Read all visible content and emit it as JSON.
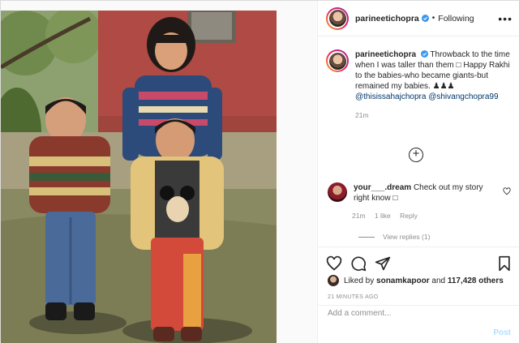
{
  "post": {
    "username": "parineetichopra",
    "follow_status": "Following",
    "dot": "•",
    "caption_text": "Throwback to the time when I was taller than them ",
    "caption_glyph": "□",
    "caption_text2": " Happy Rakhi to the babies-who became giants-but remained my babies. ",
    "caption_emoji": "♟♟♟",
    "mention1": "@thisissahajchopra",
    "mention2": "@shivangchopra99",
    "caption_time": "21m"
  },
  "comment": {
    "username": "your___.dream",
    "text": "Check out my story right know ",
    "glyph": "□",
    "time": "21m",
    "likes": "1 like",
    "reply": "Reply",
    "view_replies": "View replies (1)"
  },
  "likes": {
    "prefix": "Liked by",
    "user": "sonamkapoor",
    "and": "and",
    "count": "117,428 others"
  },
  "posted_ago": "21 MINUTES AGO",
  "add_comment": {
    "placeholder": "Add a comment...",
    "post_label": "Post"
  },
  "icons": {
    "verified": "verified-badge-icon",
    "more": "more-options-icon",
    "heart": "heart-icon",
    "comment": "comment-icon",
    "share": "share-icon",
    "bookmark": "bookmark-icon",
    "load_more": "load-more-icon"
  },
  "colors": {
    "verified": "#3897f0",
    "mention": "#00376b",
    "muted": "#8e8e8e",
    "post_button": "#b2dffc"
  }
}
